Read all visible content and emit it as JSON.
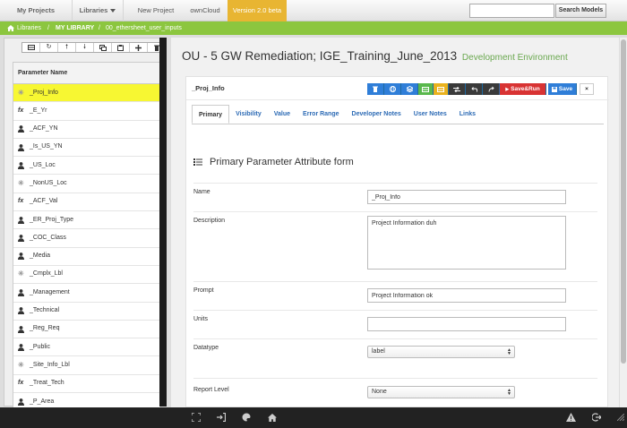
{
  "topnav": {
    "my_projects": "My Projects",
    "libraries": "Libraries",
    "new_project": "New Project",
    "owncloud": "ownCloud",
    "version": "Version 2.0 beta",
    "search_placeholder": "",
    "search_button": "Search Models"
  },
  "breadcrumb": {
    "libraries": "Libraries",
    "separator": "/",
    "my_library": "MY LIBRARY",
    "sheet": "00_ethersheet_user_inputs"
  },
  "sidebar": {
    "header": "Parameter Name",
    "items": [
      {
        "label": "_Proj_Info",
        "icon": "gear-icon",
        "selected": true
      },
      {
        "label": "_E_Yr",
        "icon": "function-icon"
      },
      {
        "label": "_ACF_YN",
        "icon": "user-icon"
      },
      {
        "label": "_Is_US_YN",
        "icon": "user-icon"
      },
      {
        "label": "_US_Loc",
        "icon": "user-icon"
      },
      {
        "label": "_NonUS_Loc",
        "icon": "gear-icon"
      },
      {
        "label": "_ACF_Val",
        "icon": "function-icon"
      },
      {
        "label": "_ER_Proj_Type",
        "icon": "user-icon"
      },
      {
        "label": "_COC_Class",
        "icon": "user-icon"
      },
      {
        "label": "_Media",
        "icon": "user-icon"
      },
      {
        "label": "_Cmplx_Lbl",
        "icon": "gear-icon"
      },
      {
        "label": "_Management",
        "icon": "user-icon"
      },
      {
        "label": "_Technical",
        "icon": "user-icon"
      },
      {
        "label": "_Reg_Req",
        "icon": "user-icon"
      },
      {
        "label": "_Public",
        "icon": "user-icon"
      },
      {
        "label": "_Site_Info_Lbl",
        "icon": "gear-icon"
      },
      {
        "label": "_Treat_Tech",
        "icon": "function-icon"
      },
      {
        "label": "_P_Area",
        "icon": "user-icon"
      }
    ]
  },
  "main": {
    "title": "OU - 5 GW Remediation; IGE_Training_June_2013",
    "environment": "Development Environment",
    "card_title": "_Proj_Info",
    "actions": {
      "save_run": "Save&Run",
      "save": "Save",
      "close": "×"
    },
    "tabs": [
      "Primary",
      "Visibility",
      "Value",
      "Error Range",
      "Developer Notes",
      "User Notes",
      "Links"
    ],
    "active_tab": "Primary",
    "form_title": "Primary Parameter Attribute form",
    "fields": {
      "name_label": "Name",
      "name_value": "_Proj_Info",
      "description_label": "Description",
      "description_value": "Project Information duh",
      "prompt_label": "Prompt",
      "prompt_value": "Project Information ok",
      "units_label": "Units",
      "units_value": "",
      "datatype_label": "Datatype",
      "datatype_value": "label",
      "report_level_label": "Report Level",
      "report_level_value": "None"
    }
  },
  "colors": {
    "breadcrumb_bg": "#8cc63f",
    "version_badge": "#e8b532",
    "selected_row": "#f7f732",
    "environment_text": "#6aa84f",
    "primary_button": "#2f7ed8",
    "save_run_button": "#d83333"
  }
}
